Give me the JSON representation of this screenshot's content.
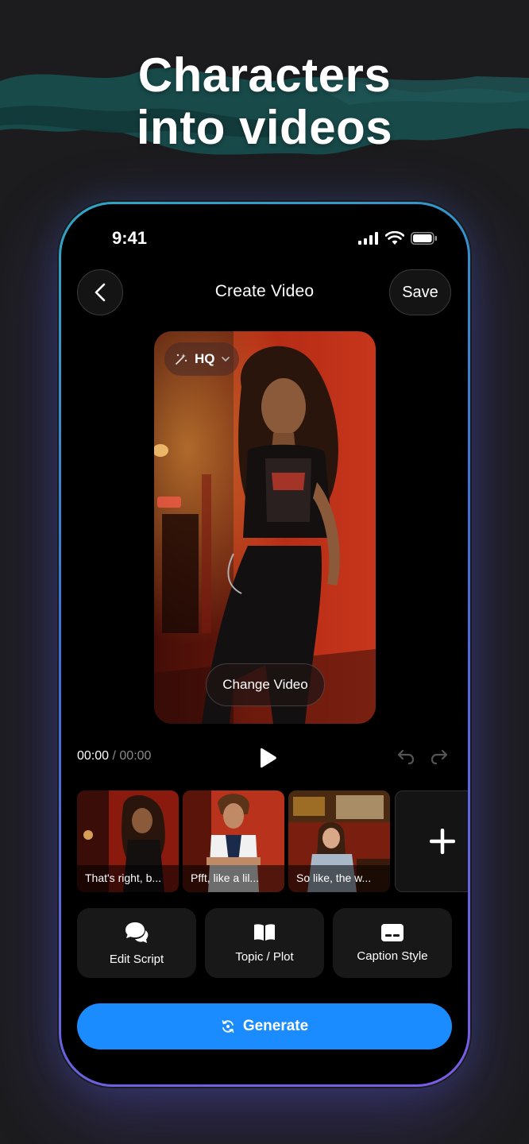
{
  "headline": {
    "line1": "Characters",
    "line2": "into videos"
  },
  "status_bar": {
    "time": "9:41"
  },
  "header": {
    "title": "Create Video",
    "save_label": "Save"
  },
  "preview": {
    "quality_label": "HQ",
    "change_label": "Change Video"
  },
  "player": {
    "current": "00:00",
    "separator": "/",
    "duration": "00:00"
  },
  "clips": [
    {
      "caption": "That's right, b..."
    },
    {
      "caption": "Pfft, like a lil..."
    },
    {
      "caption": "So like, the w..."
    }
  ],
  "tools": [
    {
      "label": "Edit Script",
      "icon": "chat-bubbles-icon"
    },
    {
      "label": "Topic / Plot",
      "icon": "open-book-icon"
    },
    {
      "label": "Caption Style",
      "icon": "caption-icon"
    }
  ],
  "generate": {
    "label": "Generate"
  },
  "colors": {
    "accent": "#1a8cff",
    "background": "#1c1c1e",
    "screen": "#000000"
  }
}
